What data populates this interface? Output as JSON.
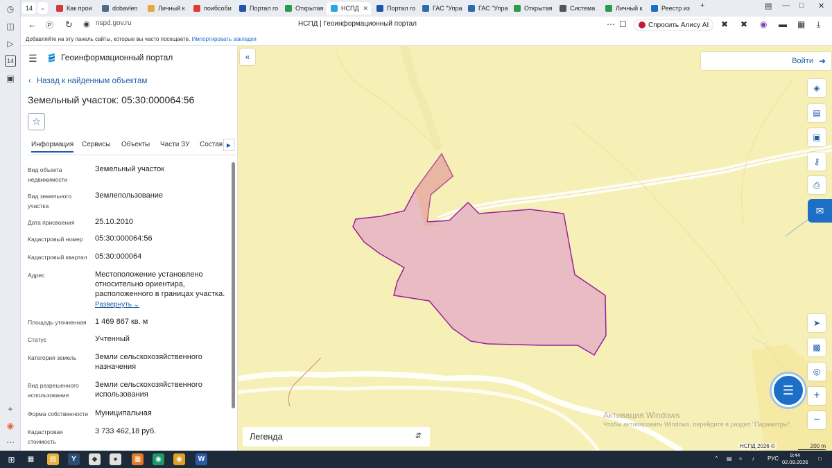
{
  "browser": {
    "tab_count": "14",
    "tabs": [
      {
        "label": "Как прои",
        "color": "#d23a3a"
      },
      {
        "label": "dobavlen",
        "color": "#4f6b88"
      },
      {
        "label": "Личный к",
        "color": "#e8a73a"
      },
      {
        "label": "поибсоби",
        "color": "#e03a30"
      },
      {
        "label": "Портал го",
        "color": "#1d56a8"
      },
      {
        "label": "Открытая",
        "color": "#2b9a4a"
      },
      {
        "label": "НСПД",
        "color": "#2aa7e0"
      },
      {
        "label": "Портал го",
        "color": "#1d56a8"
      },
      {
        "label": "ГАС \"Упра",
        "color": "#2b6cb0"
      },
      {
        "label": "ГАС \"Упра",
        "color": "#2b6cb0"
      },
      {
        "label": "Открытая",
        "color": "#2b9a4a"
      },
      {
        "label": "Система",
        "color": "#555555"
      },
      {
        "label": "Личный к",
        "color": "#2b9a4a"
      },
      {
        "label": "Реестр из",
        "color": "#1d6fc6"
      }
    ],
    "active_tab_index": 6,
    "url": "nspd.gov.ru",
    "page_title": "НСПД | Геоинформационный портал",
    "alice_button": "Спросить Алису AI",
    "bookmarks_hint": "Добавляйте на эту панель сайты, которые вы часто посещаете.",
    "bookmarks_import": "Импортировать закладки"
  },
  "panel": {
    "portal_name": "Геоинформационный портал",
    "back_link": "Назад к найденным объектам",
    "object_title": "Земельный участок: 05:30:000064:56",
    "tabs": [
      "Информация",
      "Сервисы",
      "Объекты",
      "Части ЗУ",
      "Состав"
    ],
    "expand_link": "Развернуть",
    "fields": [
      {
        "label": "Вид объекта недвижимости",
        "value": "Земельный участок"
      },
      {
        "label": "Вид земельного участка",
        "value": "Землепользование"
      },
      {
        "label": "Дата присвоения",
        "value": "25.10.2010"
      },
      {
        "label": "Кадастровый номер",
        "value": "05:30:000064:56"
      },
      {
        "label": "Кадастровый квартал",
        "value": "05:30:000064"
      },
      {
        "label": "Адрес",
        "value": "Местоположение установлено относительно ориентира, расположенного в границах участка."
      },
      {
        "label": "Площадь уточненная",
        "value": "1 469 867 кв. м"
      },
      {
        "label": "Статус",
        "value": "Учтенный"
      },
      {
        "label": "Категория земель",
        "value": "Земли сельскохозяйственного назначения"
      },
      {
        "label": "Вид разрешенного использования",
        "value": "Земли сельскохозяйственного использования"
      },
      {
        "label": "Форма собственности",
        "value": "Муниципальная"
      },
      {
        "label": "Кадастровая стоимость",
        "value": "3 733 462,18 руб."
      }
    ]
  },
  "map": {
    "login": "Войти",
    "legend": "Легенда",
    "watermark_title": "Активация Windows",
    "watermark_text": "Чтобы активировать Windows, перейдите в раздел \"Параметры\".",
    "copyright": "НСПД 2026 ©",
    "scale": "200 m",
    "parcel_fill": "#e8bcc2",
    "parcel_stroke": "#9b1f9b",
    "background": "#f7f0b6"
  },
  "taskbar": {
    "language": "РУС",
    "time": "9:44",
    "date": "02.09.2026"
  }
}
